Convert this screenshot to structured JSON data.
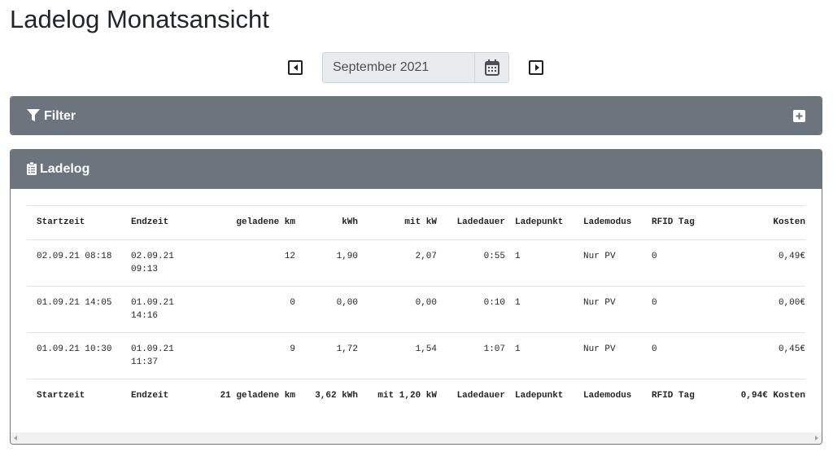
{
  "page": {
    "title": "Ladelog Monatsansicht"
  },
  "month_nav": {
    "selected_month": "September 2021",
    "prev_icon": "caret-square-left-icon",
    "next_icon": "caret-square-right-icon",
    "calendar_icon": "calendar-icon"
  },
  "filter_card": {
    "title": "Filter",
    "icon": "filter-icon",
    "expand_icon": "plus-square-icon"
  },
  "log_card": {
    "title": "Ladelog",
    "icon": "clipboard-list-icon"
  },
  "table": {
    "headers": [
      "Startzeit",
      "Endzeit",
      "geladene km",
      "kWh",
      "mit kW",
      "Ladedauer",
      "Ladepunkt",
      "Lademodus",
      "RFID Tag",
      "Kosten"
    ],
    "rows": [
      [
        "02.09.21 08:18",
        "02.09.21 09:13",
        "12",
        "1,90",
        "2,07",
        "0:55",
        "1",
        "Nur PV",
        "0",
        "0,49€"
      ],
      [
        "01.09.21 14:05",
        "01.09.21 14:16",
        "0",
        "0,00",
        "0,00",
        "0:10",
        "1",
        "Nur PV",
        "0",
        "0,00€"
      ],
      [
        "01.09.21 10:30",
        "01.09.21 11:37",
        "9",
        "1,72",
        "1,54",
        "1:07",
        "1",
        "Nur PV",
        "0",
        "0,45€"
      ]
    ],
    "footer": [
      "Startzeit",
      "Endzeit",
      "21 geladene km",
      "3,62 kWh",
      "mit 1,20 kW",
      "Ladedauer",
      "Ladepunkt",
      "Lademodus",
      "RFID Tag",
      "0,94€ Kosten"
    ]
  },
  "colors": {
    "card_header": "#6c757d",
    "input_bg": "#e9ecef",
    "border": "#dee2e6"
  }
}
